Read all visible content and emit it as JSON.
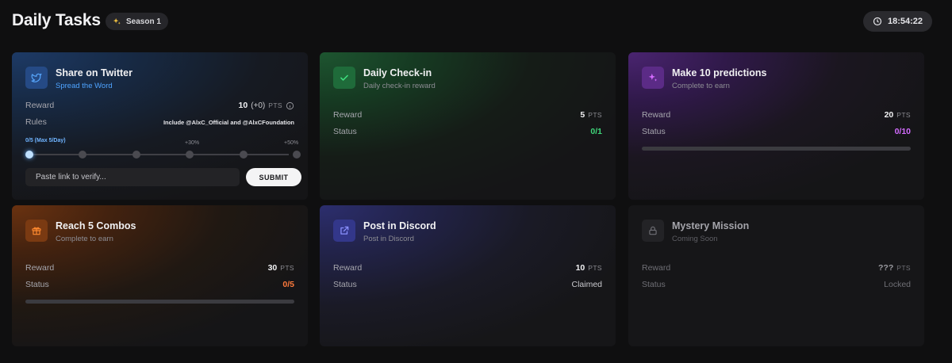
{
  "header": {
    "title": "Daily Tasks",
    "season_badge": "Season 1",
    "timer": "18:54:22"
  },
  "colors": {
    "twitter": "#2c8fff",
    "checkin": "#2bc96a",
    "predictions": "#c34cff",
    "combos": "#ff7a1a",
    "discord": "#6b73ff",
    "checkin_status": "#3fd67a",
    "predictions_status": "#d36cff",
    "combos_status": "#ff7a3c"
  },
  "cards": {
    "twitter": {
      "icon": "twitter-icon",
      "title": "Share on Twitter",
      "subtitle": "Spread the Word",
      "reward_label": "Reward",
      "reward_value": "10",
      "reward_bonus": "(+0)",
      "pts": "PTS",
      "rules_label": "Rules",
      "rules_value": "Include @AlxC_Official and @AlxCFoundation",
      "tier_current": "0/5 (Max 5/Day)",
      "tier_mid": "+30%",
      "tier_max": "+50%",
      "tier_progress": 0,
      "input_placeholder": "Paste link to verify...",
      "submit_label": "SUBMIT"
    },
    "checkin": {
      "icon": "check-icon",
      "title": "Daily Check-in",
      "subtitle": "Daily check-in reward",
      "reward_label": "Reward",
      "reward_value": "5",
      "pts": "PTS",
      "status_label": "Status",
      "status_value": "0/1"
    },
    "predictions": {
      "icon": "sparkle-icon",
      "title": "Make 10 predictions",
      "subtitle": "Complete to earn",
      "reward_label": "Reward",
      "reward_value": "20",
      "pts": "PTS",
      "status_label": "Status",
      "status_value": "0/10",
      "progress": 0
    },
    "combos": {
      "icon": "gift-icon",
      "title": "Reach 5 Combos",
      "subtitle": "Complete to earn",
      "reward_label": "Reward",
      "reward_value": "30",
      "pts": "PTS",
      "status_label": "Status",
      "status_value": "0/5",
      "progress": 0
    },
    "discord": {
      "icon": "external-link-icon",
      "title": "Post in Discord",
      "subtitle": "Post in Discord",
      "reward_label": "Reward",
      "reward_value": "10",
      "pts": "PTS",
      "status_label": "Status",
      "status_value": "Claimed"
    },
    "mystery": {
      "icon": "lock-icon",
      "title": "Mystery Mission",
      "subtitle": "Coming Soon",
      "reward_label": "Reward",
      "reward_value": "???",
      "pts": "PTS",
      "status_label": "Status",
      "status_value": "Locked"
    }
  }
}
